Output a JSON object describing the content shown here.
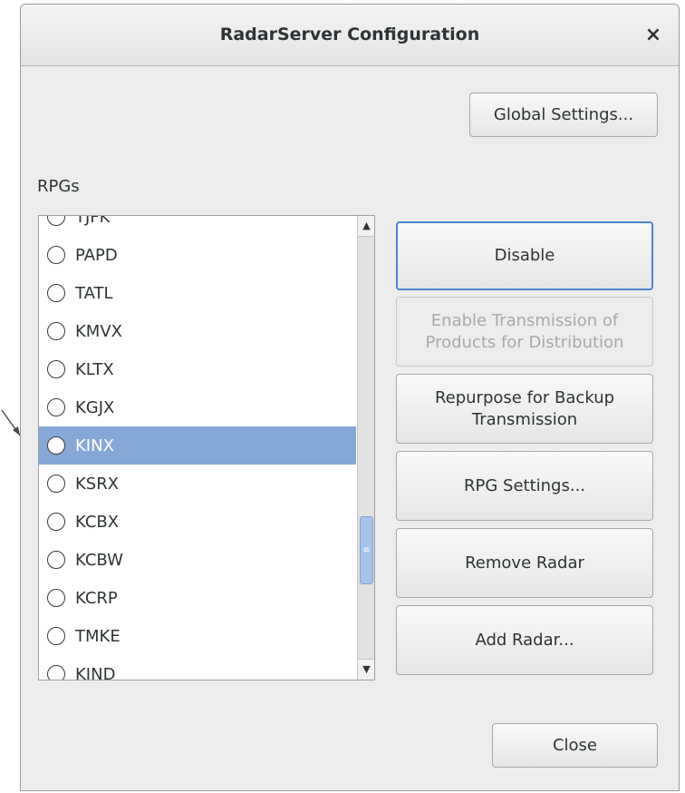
{
  "dialog": {
    "title": "RadarServer Configuration",
    "close_icon": "×"
  },
  "buttons": {
    "global_settings": "Global Settings...",
    "disable": "Disable",
    "enable_transmission": "Enable Transmission of Products for Distribution",
    "repurpose": "Repurpose for Backup Transmission",
    "rpg_settings": "RPG Settings...",
    "remove_radar": "Remove Radar",
    "add_radar": "Add Radar...",
    "close": "Close"
  },
  "rpgs": {
    "label": "RPGs",
    "selected": "KINX",
    "items": [
      "TJFK",
      "PAPD",
      "TATL",
      "KMVX",
      "KLTX",
      "KGJX",
      "KINX",
      "KSRX",
      "KCBX",
      "KCBW",
      "KCRP",
      "TMKE",
      "KIND"
    ],
    "scroll_up_icon": "▲",
    "scroll_down_icon": "▼",
    "thumb_grip": "≡"
  },
  "colors": {
    "selection": "#86a8d6",
    "focus_border": "#4a86cf",
    "disabled_text": "#a9a9a9"
  }
}
